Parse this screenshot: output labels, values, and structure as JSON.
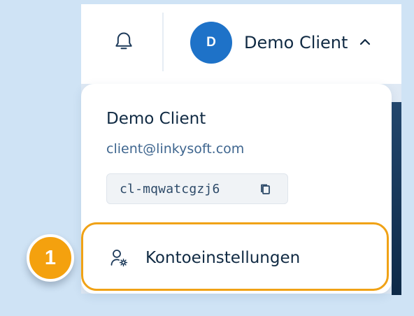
{
  "header": {
    "notifications_icon": "bell-icon",
    "avatar_initial": "D",
    "user_name": "Demo Client",
    "chevron_icon": "chevron-up-icon",
    "avatar_color": "#1e72c8"
  },
  "dropdown": {
    "name": "Demo Client",
    "email": "client@linkysoft.com",
    "client_id": "cl-mqwatcgzj6",
    "copy_icon": "copy-icon",
    "menu_item": {
      "label": "Kontoeinstellungen",
      "icon": "user-settings-icon"
    }
  },
  "annotation": {
    "step_number": "1",
    "highlight_color": "#f0a216"
  }
}
